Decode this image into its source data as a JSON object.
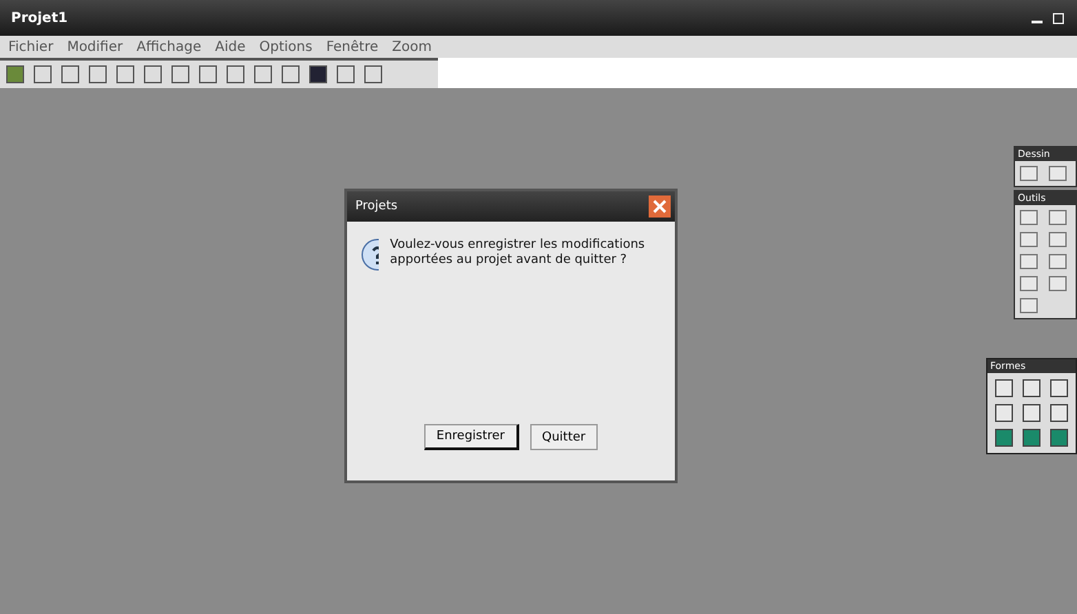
{
  "window": {
    "title": "Projet1"
  },
  "menu": [
    "Fichier",
    "Modifier",
    "Affichage",
    "Aide",
    "Options",
    "Fenêtre",
    "Zoom"
  ],
  "dialog": {
    "title": "Projets",
    "message": "Voulez-vous enregistrer les modifications apportées au projet avant de quitter ?",
    "buttons": [
      {
        "label": "Enregistrer",
        "selected": true
      },
      {
        "label": "Quitter",
        "selected": false
      }
    ]
  },
  "panels": [
    {
      "title": "Dessin"
    },
    {
      "title": "Outils"
    }
  ],
  "floating_panel": {
    "title": "Formes"
  }
}
